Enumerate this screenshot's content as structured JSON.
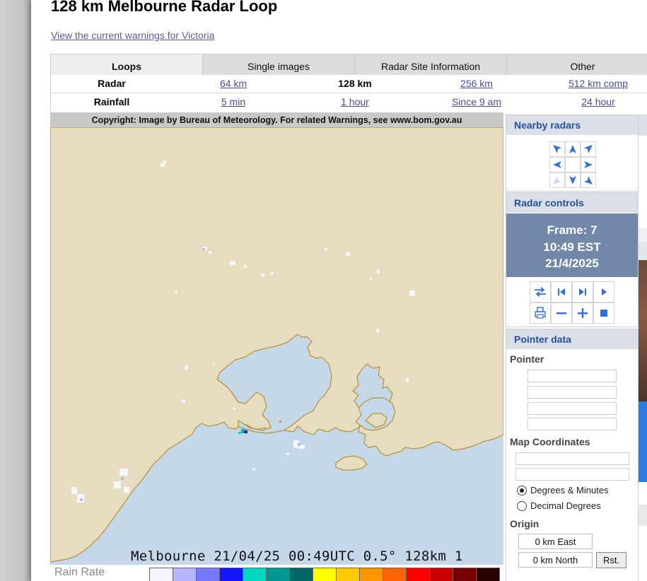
{
  "page": {
    "title": "128 km Melbourne Radar Loop",
    "warnings_link": "View the current warnings for Victoria"
  },
  "tabs": [
    "Loops",
    "Single images",
    "Radar Site Information",
    "Other"
  ],
  "rows": {
    "radar": {
      "label": "Radar",
      "cells": [
        "64 km",
        "128 km",
        "256 km",
        "512 km comp"
      ]
    },
    "rainfall": {
      "label": "Rainfall",
      "cells": [
        "5 min",
        "1 hour",
        "Since 9 am",
        "24 hour"
      ]
    }
  },
  "radar_image": {
    "copyright": "Copyright: Image by Bureau of Meteorology. For related Warnings, see www.bom.gov.au",
    "caption": "Melbourne 21/04/25 00:49UTC 0.5° 128km 1",
    "legend_label": "Rain Rate",
    "legend_colors": [
      "#f5f5ff",
      "#b4b4ff",
      "#7878ff",
      "#1414ff",
      "#00d8c3",
      "#009690",
      "#006666",
      "#ffff00",
      "#ffc800",
      "#ff9600",
      "#ff6400",
      "#ff0000",
      "#c80000",
      "#780000",
      "#280000"
    ]
  },
  "nearby": {
    "title": "Nearby radars",
    "arrows": [
      "arrow-up-left-icon",
      "arrow-up-icon",
      "arrow-up-right-icon",
      "arrow-left-icon",
      "",
      "arrow-right-icon",
      "arrow-down-left-icon",
      "arrow-down-icon",
      "arrow-down-right-icon"
    ]
  },
  "controls": {
    "title": "Radar controls",
    "frame": "Frame: 7",
    "time": "10:49 EST",
    "date": "21/4/2025"
  },
  "pointer": {
    "title": "Pointer data",
    "pointer_label": "Pointer",
    "map_coords_label": "Map Coordinates",
    "options": [
      "Degrees & Minutes",
      "Decimal Degrees"
    ],
    "origin_label": "Origin",
    "origin_east": "0 km East",
    "origin_north": "0 km North",
    "reset": "Rst."
  }
}
